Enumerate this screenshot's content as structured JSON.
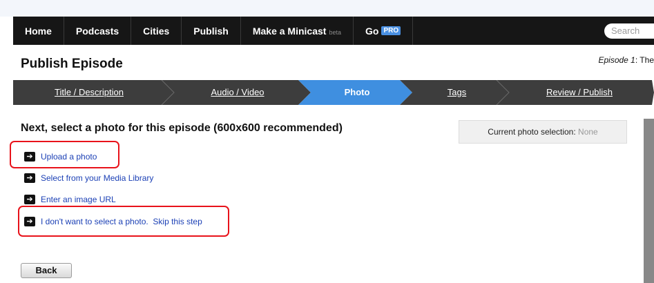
{
  "nav": {
    "items": [
      "Home",
      "Podcasts",
      "Cities",
      "Publish"
    ],
    "minicast_label": "Make a Minicast",
    "minicast_badge": "beta",
    "go_label": "Go",
    "pro_badge": "PRO",
    "search_placeholder": "Search"
  },
  "header": {
    "title": "Publish Episode",
    "episode_prefix": "Episode 1",
    "episode_suffix": ": The"
  },
  "steps": [
    {
      "label": "Title / Description",
      "active": false
    },
    {
      "label": "Audio / Video",
      "active": false
    },
    {
      "label": "Photo",
      "active": true
    },
    {
      "label": "Tags",
      "active": false
    },
    {
      "label": "Review / Publish",
      "active": false
    }
  ],
  "main": {
    "instruction": "Next, select a photo for this episode (600x600 recommended)",
    "options": [
      "Upload a photo",
      "Select from your Media Library",
      "Enter an image URL",
      "I don't want to select a photo.  Skip this step"
    ],
    "current_photo_label": "Current photo selection:",
    "current_photo_value": "None",
    "back_label": "Back"
  },
  "colors": {
    "nav_background": "#161616",
    "step_inactive": "#3d3d3d",
    "step_active": "#3f8fe0",
    "link": "#1a3fb5",
    "highlight": "#e8121a"
  }
}
